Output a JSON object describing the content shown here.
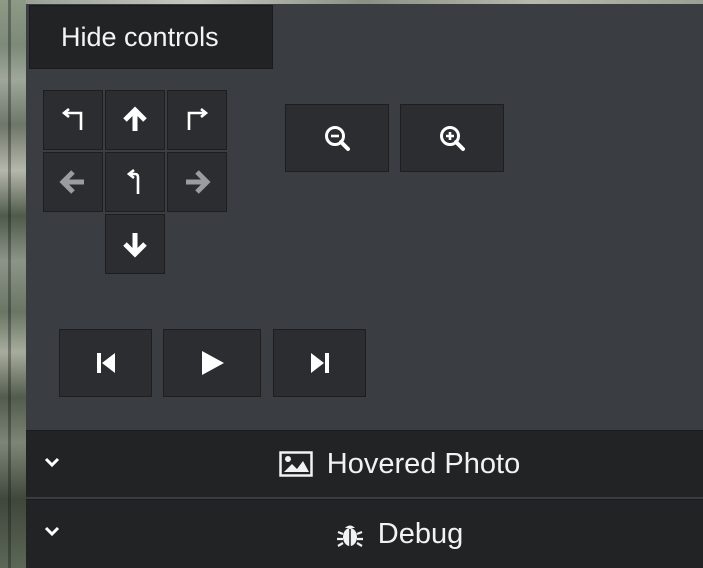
{
  "controls": {
    "hide_label": "Hide controls"
  },
  "sections": {
    "hovered_photo_label": "Hovered Photo",
    "debug_label": "Debug"
  },
  "icons": {
    "turn_left": "turn-left-icon",
    "arrow_up": "arrow-up-icon",
    "turn_right": "turn-right-icon",
    "arrow_left": "arrow-left-icon",
    "u_turn": "u-turn-icon",
    "arrow_right": "arrow-right-icon",
    "arrow_down": "arrow-down-icon",
    "zoom_out": "zoom-out-icon",
    "zoom_in": "zoom-in-icon",
    "skip_previous": "skip-previous-icon",
    "play": "play-icon",
    "skip_next": "skip-next-icon",
    "image": "image-icon",
    "bug": "bug-icon",
    "chevron": "chevron-down-icon"
  },
  "colors": {
    "panel": "#3a3d42",
    "button": "#2b2d30",
    "bar": "#222325",
    "text": "#f2f2f2",
    "dim_icon": "#9a9c9f"
  }
}
